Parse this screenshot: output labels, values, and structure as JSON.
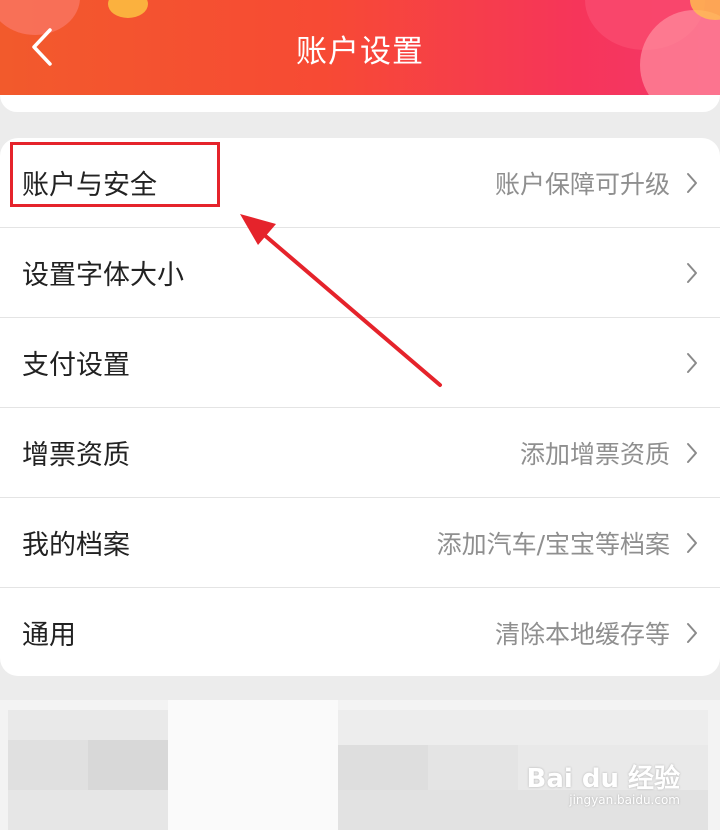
{
  "header": {
    "title": "账户设置",
    "back_icon": "chevron-left-icon",
    "colors": {
      "gradient_start": "#f25a2c",
      "gradient_end": "#f3386a"
    }
  },
  "settings": {
    "items": [
      {
        "label": "账户与安全",
        "value": "账户保障可升级"
      },
      {
        "label": "设置字体大小",
        "value": ""
      },
      {
        "label": "支付设置",
        "value": ""
      },
      {
        "label": "增票资质",
        "value": "添加增票资质"
      },
      {
        "label": "我的档案",
        "value": "添加汽车/宝宝等档案"
      },
      {
        "label": "通用",
        "value": "清除本地缓存等"
      }
    ]
  },
  "annotation": {
    "highlight_color": "#e5232b"
  },
  "watermark": {
    "main": "Bai du 经验",
    "sub": "jingyan.baidu.com"
  }
}
